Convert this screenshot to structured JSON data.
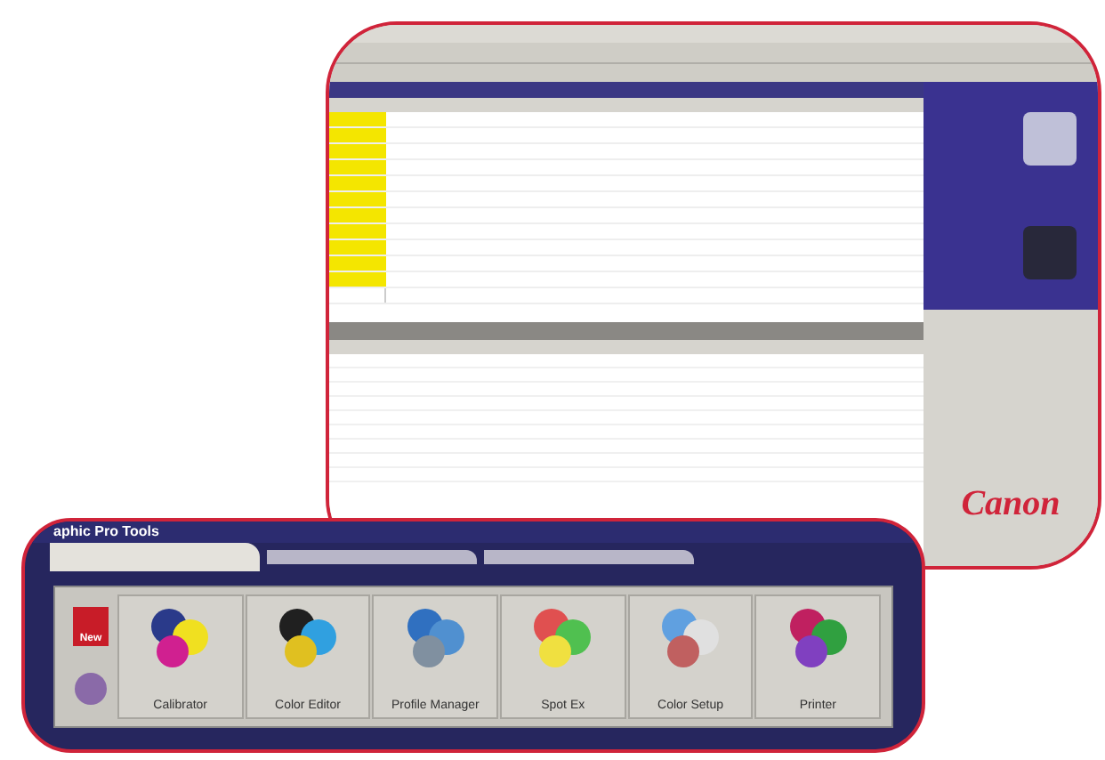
{
  "list_window": {
    "rows": [
      {
        "highlighted": true
      },
      {
        "highlighted": true
      },
      {
        "highlighted": true
      },
      {
        "highlighted": true
      },
      {
        "highlighted": true
      },
      {
        "highlighted": true
      },
      {
        "highlighted": true
      },
      {
        "highlighted": true
      },
      {
        "highlighted": true
      },
      {
        "highlighted": true
      },
      {
        "highlighted": true
      },
      {
        "highlighted": false
      }
    ],
    "logo": "Canon"
  },
  "tools_window": {
    "title": "aphic Pro Tools",
    "tabs": [
      {
        "selected": true
      },
      {
        "selected": false
      },
      {
        "selected": false
      }
    ],
    "new_button": "New",
    "tools": [
      {
        "label": "Calibrator"
      },
      {
        "label": "Color Editor"
      },
      {
        "label": "Profile Manager"
      },
      {
        "label": "Spot Ex"
      },
      {
        "label": "Color Setup"
      },
      {
        "label": "Printer"
      }
    ]
  }
}
